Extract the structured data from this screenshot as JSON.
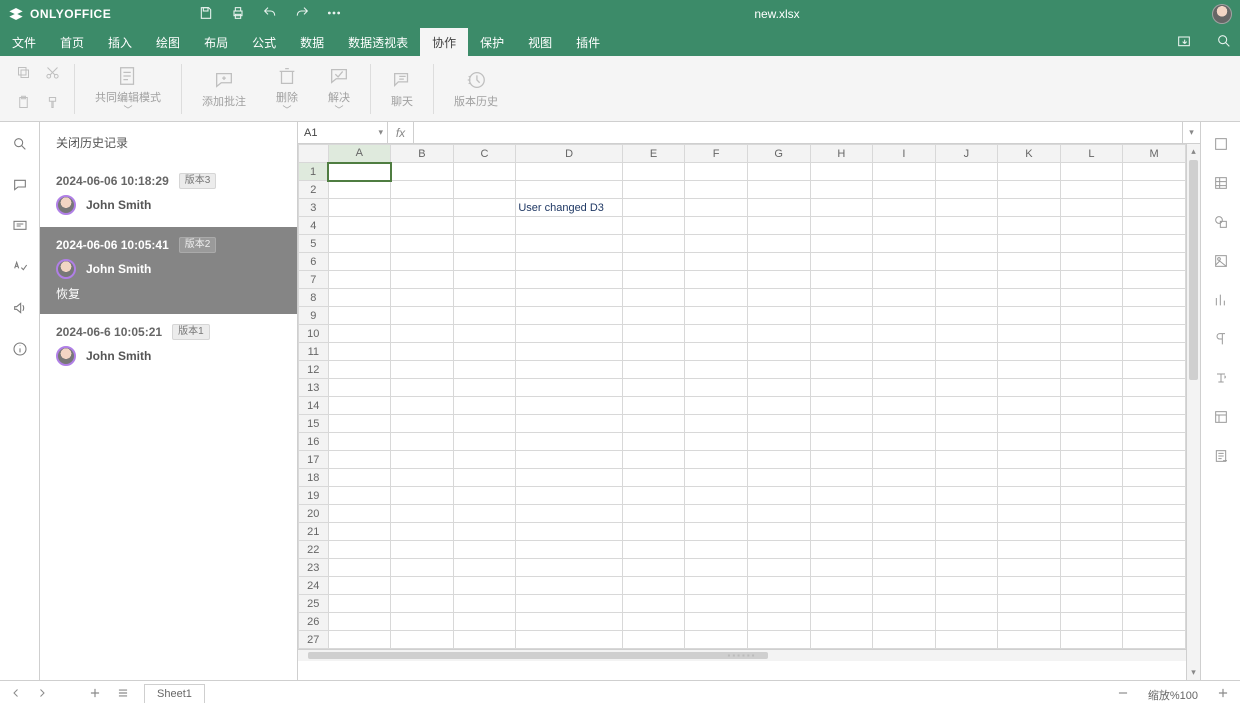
{
  "app": {
    "name": "ONLYOFFICE",
    "doc_title": "new.xlsx"
  },
  "menu": {
    "items": [
      "文件",
      "首页",
      "插入",
      "绘图",
      "布局",
      "公式",
      "数据",
      "数据透视表",
      "协作",
      "保护",
      "视图",
      "插件"
    ],
    "active_index": 8
  },
  "ribbon": {
    "coedit": "共同编辑模式",
    "addcomment": "添加批注",
    "delete": "删除",
    "resolve": "解决",
    "chat": "聊天",
    "history": "版本历史"
  },
  "history_panel": {
    "title": "关闭历史记录",
    "versions": [
      {
        "timestamp": "2024-06-06 10:18:29",
        "badge": "版本3",
        "user": "John Smith",
        "selected": false
      },
      {
        "timestamp": "2024-06-06 10:05:41",
        "badge": "版本2",
        "user": "John Smith",
        "selected": true,
        "restore_label": "恢复"
      },
      {
        "timestamp": "2024-06-6 10:05:21",
        "badge": "版本1",
        "user": "John Smith",
        "selected": false
      }
    ]
  },
  "formula_bar": {
    "name_box": "A1",
    "formula": ""
  },
  "sheet": {
    "columns": [
      "A",
      "B",
      "C",
      "D",
      "E",
      "F",
      "G",
      "H",
      "I",
      "J",
      "K",
      "L",
      "M"
    ],
    "rows": 27,
    "active_cell": "A1",
    "cells": {
      "D3": "User changed D3"
    },
    "tab_name": "Sheet1"
  },
  "status": {
    "zoom_label": "缩放%100"
  }
}
